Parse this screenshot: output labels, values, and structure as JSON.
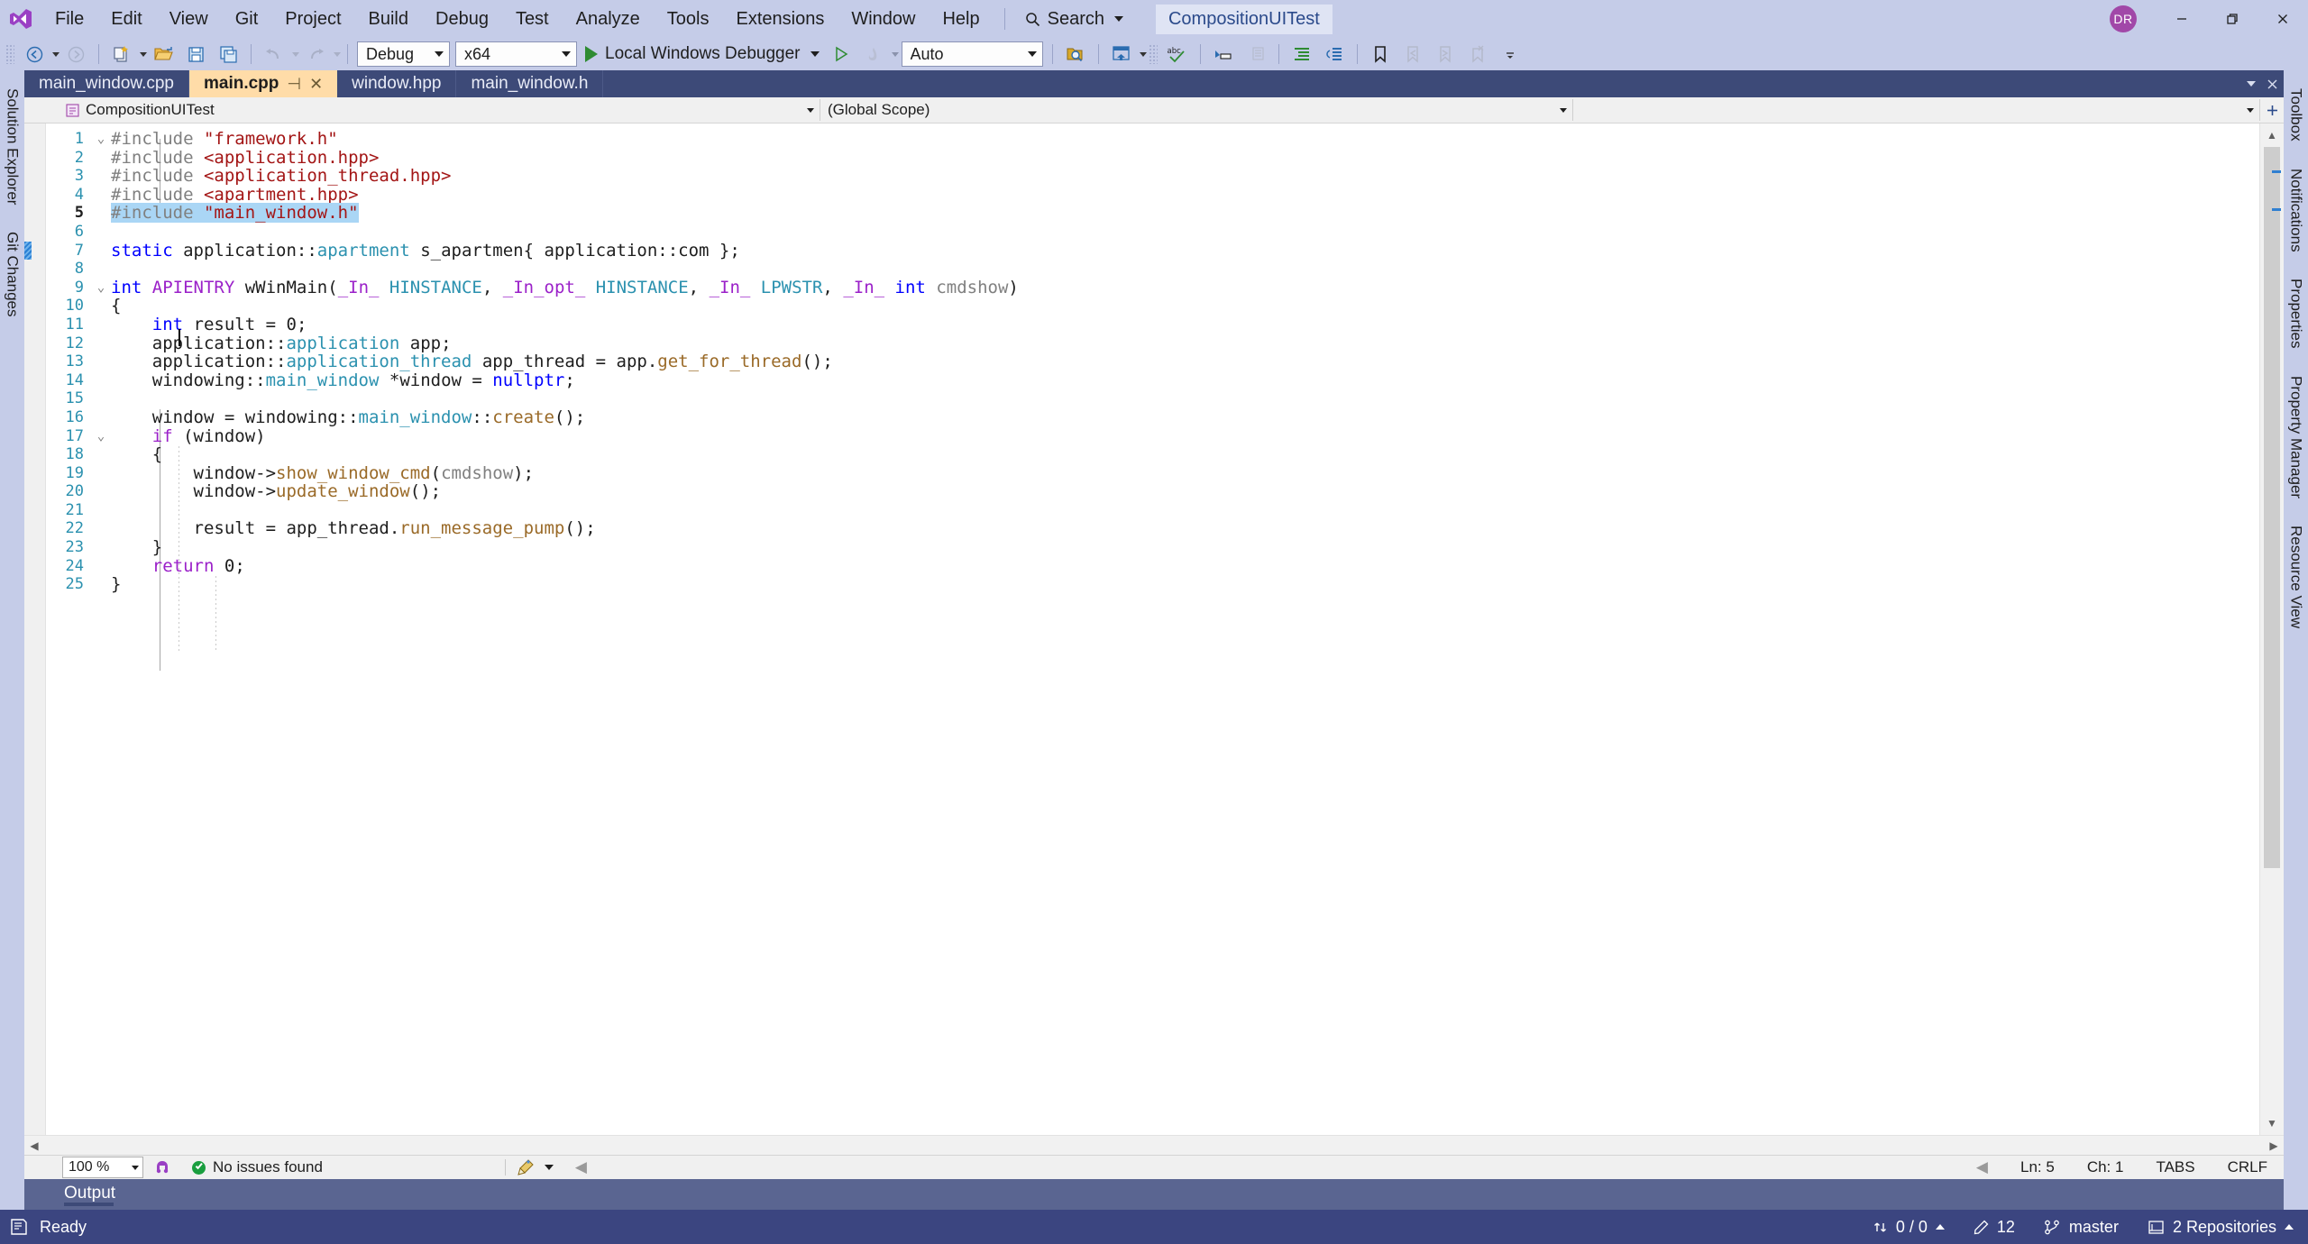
{
  "window": {
    "solution_name": "CompositionUITest",
    "user_initials": "DR",
    "minimize": "minimize-icon",
    "restore": "restore-icon",
    "close": "close-icon"
  },
  "menu": {
    "items": [
      "File",
      "Edit",
      "View",
      "Git",
      "Project",
      "Build",
      "Debug",
      "Test",
      "Analyze",
      "Tools",
      "Extensions",
      "Window",
      "Help"
    ],
    "search_label": "Search"
  },
  "toolbar": {
    "nav_back": "back-icon",
    "nav_forward": "forward-icon",
    "new_project": "new-project-icon",
    "open_file": "open-file-icon",
    "save": "save-icon",
    "save_all": "save-all-icon",
    "undo": "undo-icon",
    "redo": "redo-icon",
    "configuration": "Debug",
    "platform": "x64",
    "start_debug_label": "Local Windows Debugger",
    "auto_value": "Auto",
    "find_in_files": "find-in-files-icon",
    "window_layout": "window-layout-icon",
    "spell_check": "spell-check-icon",
    "comment": "comment-icon",
    "uncomment": "uncomment-icon",
    "indent": "indent-icon",
    "outdent": "outdent-icon",
    "toggle_bookmark": "bookmark-icon",
    "prev_bookmark": "prev-bookmark-icon",
    "next_bookmark": "next-bookmark-icon",
    "clear_bookmarks": "clear-bookmarks-icon"
  },
  "left_strip": {
    "tabs": [
      {
        "label": "Solution Explorer",
        "icon": "solution-explorer-icon"
      },
      {
        "label": "Git Changes",
        "icon": "git-changes-icon"
      }
    ]
  },
  "right_strip": {
    "tabs": [
      {
        "label": "Toolbox",
        "icon": "toolbox-icon"
      },
      {
        "label": "Notifications",
        "icon": "notifications-icon"
      },
      {
        "label": "Properties",
        "icon": "properties-icon"
      },
      {
        "label": "Property Manager",
        "icon": "property-manager-icon"
      },
      {
        "label": "Resource View",
        "icon": "resource-view-icon"
      }
    ]
  },
  "tabs": [
    {
      "label": "main_window.cpp",
      "active": false
    },
    {
      "label": "main.cpp",
      "active": true,
      "pin": "pin-icon",
      "close": "close-icon"
    },
    {
      "label": "window.hpp",
      "active": false
    },
    {
      "label": "main_window.h",
      "active": false
    }
  ],
  "navbar": {
    "project": "CompositionUITest",
    "scope": "(Global Scope)",
    "member": "",
    "project_icon": "cpp-project-icon",
    "add_split_icon": "split-view-icon"
  },
  "editor": {
    "current_line": 5,
    "lines": [
      {
        "n": 1,
        "fold": "open",
        "changed": false,
        "tokens": [
          {
            "t": "#include ",
            "c": "pp"
          },
          {
            "t": "\"framework.h\"",
            "c": "st"
          }
        ]
      },
      {
        "n": 2,
        "fold": "",
        "changed": false,
        "tokens": [
          {
            "t": "#include ",
            "c": "pp"
          },
          {
            "t": "<application.hpp>",
            "c": "st"
          }
        ]
      },
      {
        "n": 3,
        "fold": "",
        "changed": false,
        "tokens": [
          {
            "t": "#include ",
            "c": "pp"
          },
          {
            "t": "<application_thread.hpp>",
            "c": "st"
          }
        ]
      },
      {
        "n": 4,
        "fold": "",
        "changed": false,
        "tokens": [
          {
            "t": "#include ",
            "c": "pp"
          },
          {
            "t": "<apartment.hpp>",
            "c": "st"
          }
        ]
      },
      {
        "n": 5,
        "fold": "",
        "changed": false,
        "selected": true,
        "tokens": [
          {
            "t": "#include ",
            "c": "pp sel"
          },
          {
            "t": "\"main_window.h\"",
            "c": "st sel"
          }
        ]
      },
      {
        "n": 6,
        "fold": "",
        "changed": false,
        "tokens": []
      },
      {
        "n": 7,
        "fold": "",
        "changed": true,
        "tokens": [
          {
            "t": "static",
            "c": "k"
          },
          {
            "t": " application::",
            "c": "op"
          },
          {
            "t": "apartment",
            "c": "ty"
          },
          {
            "t": " s_apartmen{ application::com };",
            "c": "op"
          }
        ]
      },
      {
        "n": 8,
        "fold": "",
        "changed": false,
        "tokens": []
      },
      {
        "n": 9,
        "fold": "open",
        "changed": false,
        "tokens": [
          {
            "t": "int",
            "c": "k"
          },
          {
            "t": " ",
            "c": "op"
          },
          {
            "t": "APIENTRY",
            "c": "kp"
          },
          {
            "t": " wWinMain(",
            "c": "op"
          },
          {
            "t": "_In_",
            "c": "kp"
          },
          {
            "t": " ",
            "c": "op"
          },
          {
            "t": "HINSTANCE",
            "c": "ty"
          },
          {
            "t": ", ",
            "c": "op"
          },
          {
            "t": "_In_opt_",
            "c": "kp"
          },
          {
            "t": " ",
            "c": "op"
          },
          {
            "t": "HINSTANCE",
            "c": "ty"
          },
          {
            "t": ", ",
            "c": "op"
          },
          {
            "t": "_In_",
            "c": "kp"
          },
          {
            "t": " ",
            "c": "op"
          },
          {
            "t": "LPWSTR",
            "c": "ty"
          },
          {
            "t": ", ",
            "c": "op"
          },
          {
            "t": "_In_",
            "c": "kp"
          },
          {
            "t": " ",
            "c": "op"
          },
          {
            "t": "int",
            "c": "k"
          },
          {
            "t": " ",
            "c": "op"
          },
          {
            "t": "cmdshow",
            "c": "pm"
          },
          {
            "t": ")",
            "c": "op"
          }
        ]
      },
      {
        "n": 10,
        "fold": "",
        "changed": false,
        "tokens": [
          {
            "t": "{",
            "c": "op"
          }
        ]
      },
      {
        "n": 11,
        "fold": "",
        "changed": false,
        "tokens": [
          {
            "t": "    ",
            "c": "op"
          },
          {
            "t": "int",
            "c": "k"
          },
          {
            "t": " result = ",
            "c": "op"
          },
          {
            "t": "0",
            "c": "op"
          },
          {
            "t": ";",
            "c": "op"
          }
        ]
      },
      {
        "n": 12,
        "fold": "",
        "changed": false,
        "tokens": [
          {
            "t": "    application::",
            "c": "op"
          },
          {
            "t": "application",
            "c": "ty"
          },
          {
            "t": " app;",
            "c": "op"
          }
        ]
      },
      {
        "n": 13,
        "fold": "",
        "changed": false,
        "tokens": [
          {
            "t": "    application::",
            "c": "op"
          },
          {
            "t": "application_thread",
            "c": "ty"
          },
          {
            "t": " app_thread = app.",
            "c": "op"
          },
          {
            "t": "get_for_thread",
            "c": "fn"
          },
          {
            "t": "();",
            "c": "op"
          }
        ]
      },
      {
        "n": 14,
        "fold": "",
        "changed": false,
        "tokens": [
          {
            "t": "    windowing::",
            "c": "op"
          },
          {
            "t": "main_window",
            "c": "ty"
          },
          {
            "t": " *window = ",
            "c": "op"
          },
          {
            "t": "nullptr",
            "c": "k"
          },
          {
            "t": ";",
            "c": "op"
          }
        ]
      },
      {
        "n": 15,
        "fold": "",
        "changed": false,
        "tokens": []
      },
      {
        "n": 16,
        "fold": "",
        "changed": false,
        "tokens": [
          {
            "t": "    window = windowing::",
            "c": "op"
          },
          {
            "t": "main_window",
            "c": "ty"
          },
          {
            "t": "::",
            "c": "op"
          },
          {
            "t": "create",
            "c": "fn"
          },
          {
            "t": "();",
            "c": "op"
          }
        ]
      },
      {
        "n": 17,
        "fold": "open",
        "changed": false,
        "tokens": [
          {
            "t": "    ",
            "c": "op"
          },
          {
            "t": "if",
            "c": "kp"
          },
          {
            "t": " (window)",
            "c": "op"
          }
        ]
      },
      {
        "n": 18,
        "fold": "",
        "changed": false,
        "tokens": [
          {
            "t": "    {",
            "c": "op"
          }
        ]
      },
      {
        "n": 19,
        "fold": "",
        "changed": false,
        "tokens": [
          {
            "t": "        window->",
            "c": "op"
          },
          {
            "t": "show_window_cmd",
            "c": "fn"
          },
          {
            "t": "(",
            "c": "op"
          },
          {
            "t": "cmdshow",
            "c": "pm"
          },
          {
            "t": ");",
            "c": "op"
          }
        ]
      },
      {
        "n": 20,
        "fold": "",
        "changed": false,
        "tokens": [
          {
            "t": "        window->",
            "c": "op"
          },
          {
            "t": "update_window",
            "c": "fn"
          },
          {
            "t": "();",
            "c": "op"
          }
        ]
      },
      {
        "n": 21,
        "fold": "",
        "changed": false,
        "tokens": []
      },
      {
        "n": 22,
        "fold": "",
        "changed": false,
        "tokens": [
          {
            "t": "        result = app_thread.",
            "c": "op"
          },
          {
            "t": "run_message_pump",
            "c": "fn"
          },
          {
            "t": "();",
            "c": "op"
          }
        ]
      },
      {
        "n": 23,
        "fold": "",
        "changed": false,
        "tokens": [
          {
            "t": "    }",
            "c": "op"
          }
        ]
      },
      {
        "n": 24,
        "fold": "",
        "changed": false,
        "tokens": [
          {
            "t": "    ",
            "c": "op"
          },
          {
            "t": "return",
            "c": "kp"
          },
          {
            "t": " ",
            "c": "op"
          },
          {
            "t": "0",
            "c": "op"
          },
          {
            "t": ";",
            "c": "op"
          }
        ]
      },
      {
        "n": 25,
        "fold": "",
        "changed": false,
        "tokens": [
          {
            "t": "}",
            "c": "op"
          }
        ]
      }
    ]
  },
  "editor_status": {
    "zoom": "100 %",
    "screen_reader_icon": "screen-reader-icon",
    "issues_text": "No issues found",
    "issues_icon": "ok-circle-icon",
    "quickfix_icon": "broom-icon",
    "collapse_icon": "collapse-left-icon",
    "line": "Ln: 5",
    "column": "Ch: 1",
    "indent_mode": "TABS",
    "line_endings": "CRLF"
  },
  "output_pane": {
    "tab_label": "Output"
  },
  "statusbar": {
    "ready_text": "Ready",
    "ready_icon": "status-ready-icon",
    "source_control_icon": "source-control-icon",
    "updown_counts": "0 / 0",
    "pending_edits_icon": "pencil-icon",
    "pending_edits_count": "12",
    "branch_icon": "branch-icon",
    "branch_name": "master",
    "repo_icon": "repository-icon",
    "repo_text": "2 Repositories"
  },
  "colors": {
    "chrome": "#c5cce8",
    "statusbar": "#3b4580",
    "tab_active": "#ffdca8",
    "tabrow": "#3d4a78",
    "accent_purple": "#a148a8",
    "selection": "#aad6f5"
  }
}
